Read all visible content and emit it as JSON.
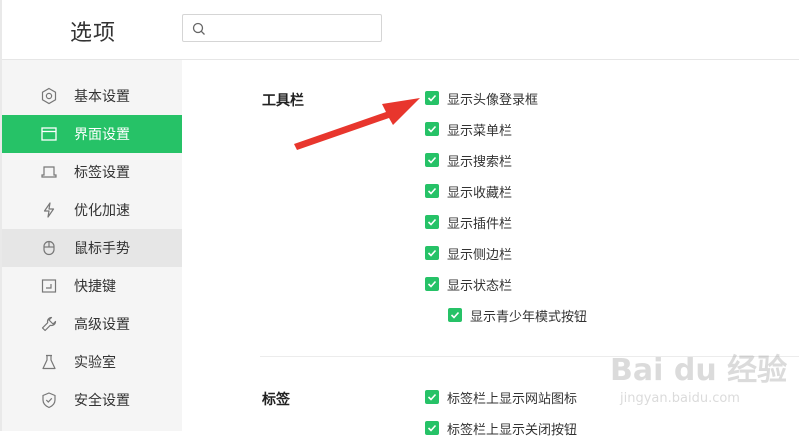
{
  "header": {
    "title": "选项",
    "search_placeholder": ""
  },
  "sidebar": {
    "items": [
      {
        "label": "基本设置",
        "icon": "hexagon-settings-icon"
      },
      {
        "label": "界面设置",
        "icon": "window-icon"
      },
      {
        "label": "标签设置",
        "icon": "tab-icon"
      },
      {
        "label": "优化加速",
        "icon": "lightning-icon"
      },
      {
        "label": "鼠标手势",
        "icon": "mouse-icon"
      },
      {
        "label": "快捷键",
        "icon": "keyboard-shortcut-icon"
      },
      {
        "label": "高级设置",
        "icon": "wrench-icon"
      },
      {
        "label": "实验室",
        "icon": "flask-icon"
      },
      {
        "label": "安全设置",
        "icon": "shield-icon"
      }
    ],
    "active_index": 1,
    "hover_index": 4
  },
  "toolbar_section": {
    "title": "工具栏",
    "options": [
      {
        "label": "显示头像登录框",
        "checked": true
      },
      {
        "label": "显示菜单栏",
        "checked": true
      },
      {
        "label": "显示搜索栏",
        "checked": true
      },
      {
        "label": "显示收藏栏",
        "checked": true
      },
      {
        "label": "显示插件栏",
        "checked": true
      },
      {
        "label": "显示侧边栏",
        "checked": true
      },
      {
        "label": "显示状态栏",
        "checked": true
      },
      {
        "label": "显示青少年模式按钮",
        "checked": true
      }
    ]
  },
  "tabs_section": {
    "title": "标签",
    "options": [
      {
        "label": "标签栏上显示网站图标",
        "checked": true
      },
      {
        "label": "标签栏上显示关闭按钮",
        "checked": true
      }
    ]
  },
  "watermark": {
    "line1": "Bai du 经验",
    "line2": "jingyan.baidu.com"
  },
  "colors": {
    "accent": "#26c267",
    "arrow": "#e8362d",
    "sidebar_bg": "#f5f5f5",
    "hover_bg": "#e6e6e6"
  }
}
